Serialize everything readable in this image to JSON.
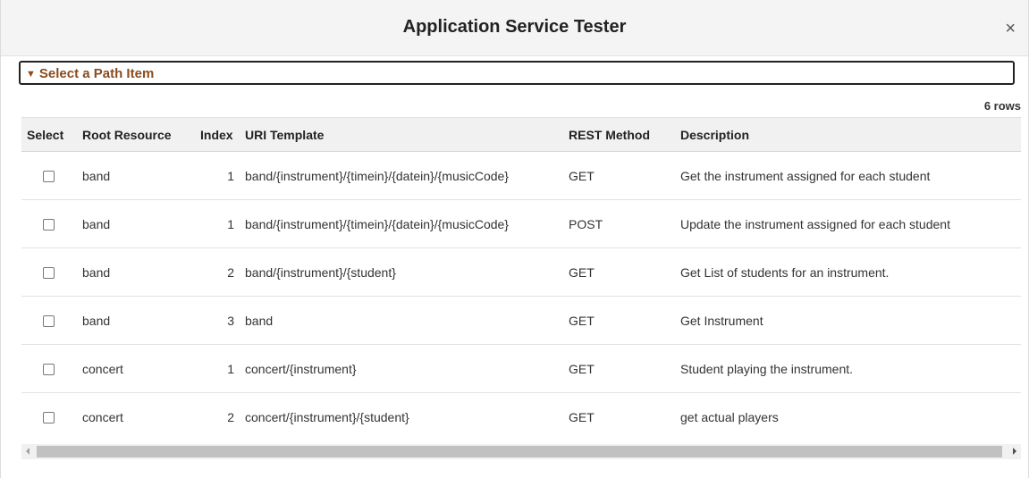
{
  "dialog": {
    "title": "Application Service Tester",
    "close_glyph": "×"
  },
  "section": {
    "label": "Select a Path Item",
    "icon": "triangle-down-icon",
    "label_color": "#8a4b1e"
  },
  "grid": {
    "row_count": "6 rows",
    "headers": {
      "select": "Select",
      "root_resource": "Root Resource",
      "index": "Index",
      "uri_template": "URI Template",
      "rest_method": "REST Method",
      "description": "Description"
    },
    "rows": [
      {
        "root_resource": "band",
        "index": "1",
        "uri_template": "band/{instrument}/{timein}/{datein}/{musicCode}",
        "rest_method": "GET",
        "description": "Get the instrument assigned for each student",
        "selected": false
      },
      {
        "root_resource": "band",
        "index": "1",
        "uri_template": "band/{instrument}/{timein}/{datein}/{musicCode}",
        "rest_method": "POST",
        "description": "Update the instrument assigned for each student",
        "selected": false
      },
      {
        "root_resource": "band",
        "index": "2",
        "uri_template": "band/{instrument}/{student}",
        "rest_method": "GET",
        "description": "Get List of students for an instrument.",
        "selected": false
      },
      {
        "root_resource": "band",
        "index": "3",
        "uri_template": "band",
        "rest_method": "GET",
        "description": "Get Instrument",
        "selected": false
      },
      {
        "root_resource": "concert",
        "index": "1",
        "uri_template": "concert/{instrument}",
        "rest_method": "GET",
        "description": "Student playing the instrument.",
        "selected": false
      },
      {
        "root_resource": "concert",
        "index": "2",
        "uri_template": "concert/{instrument}/{student}",
        "rest_method": "GET",
        "description": "get actual players",
        "selected": false
      }
    ]
  }
}
